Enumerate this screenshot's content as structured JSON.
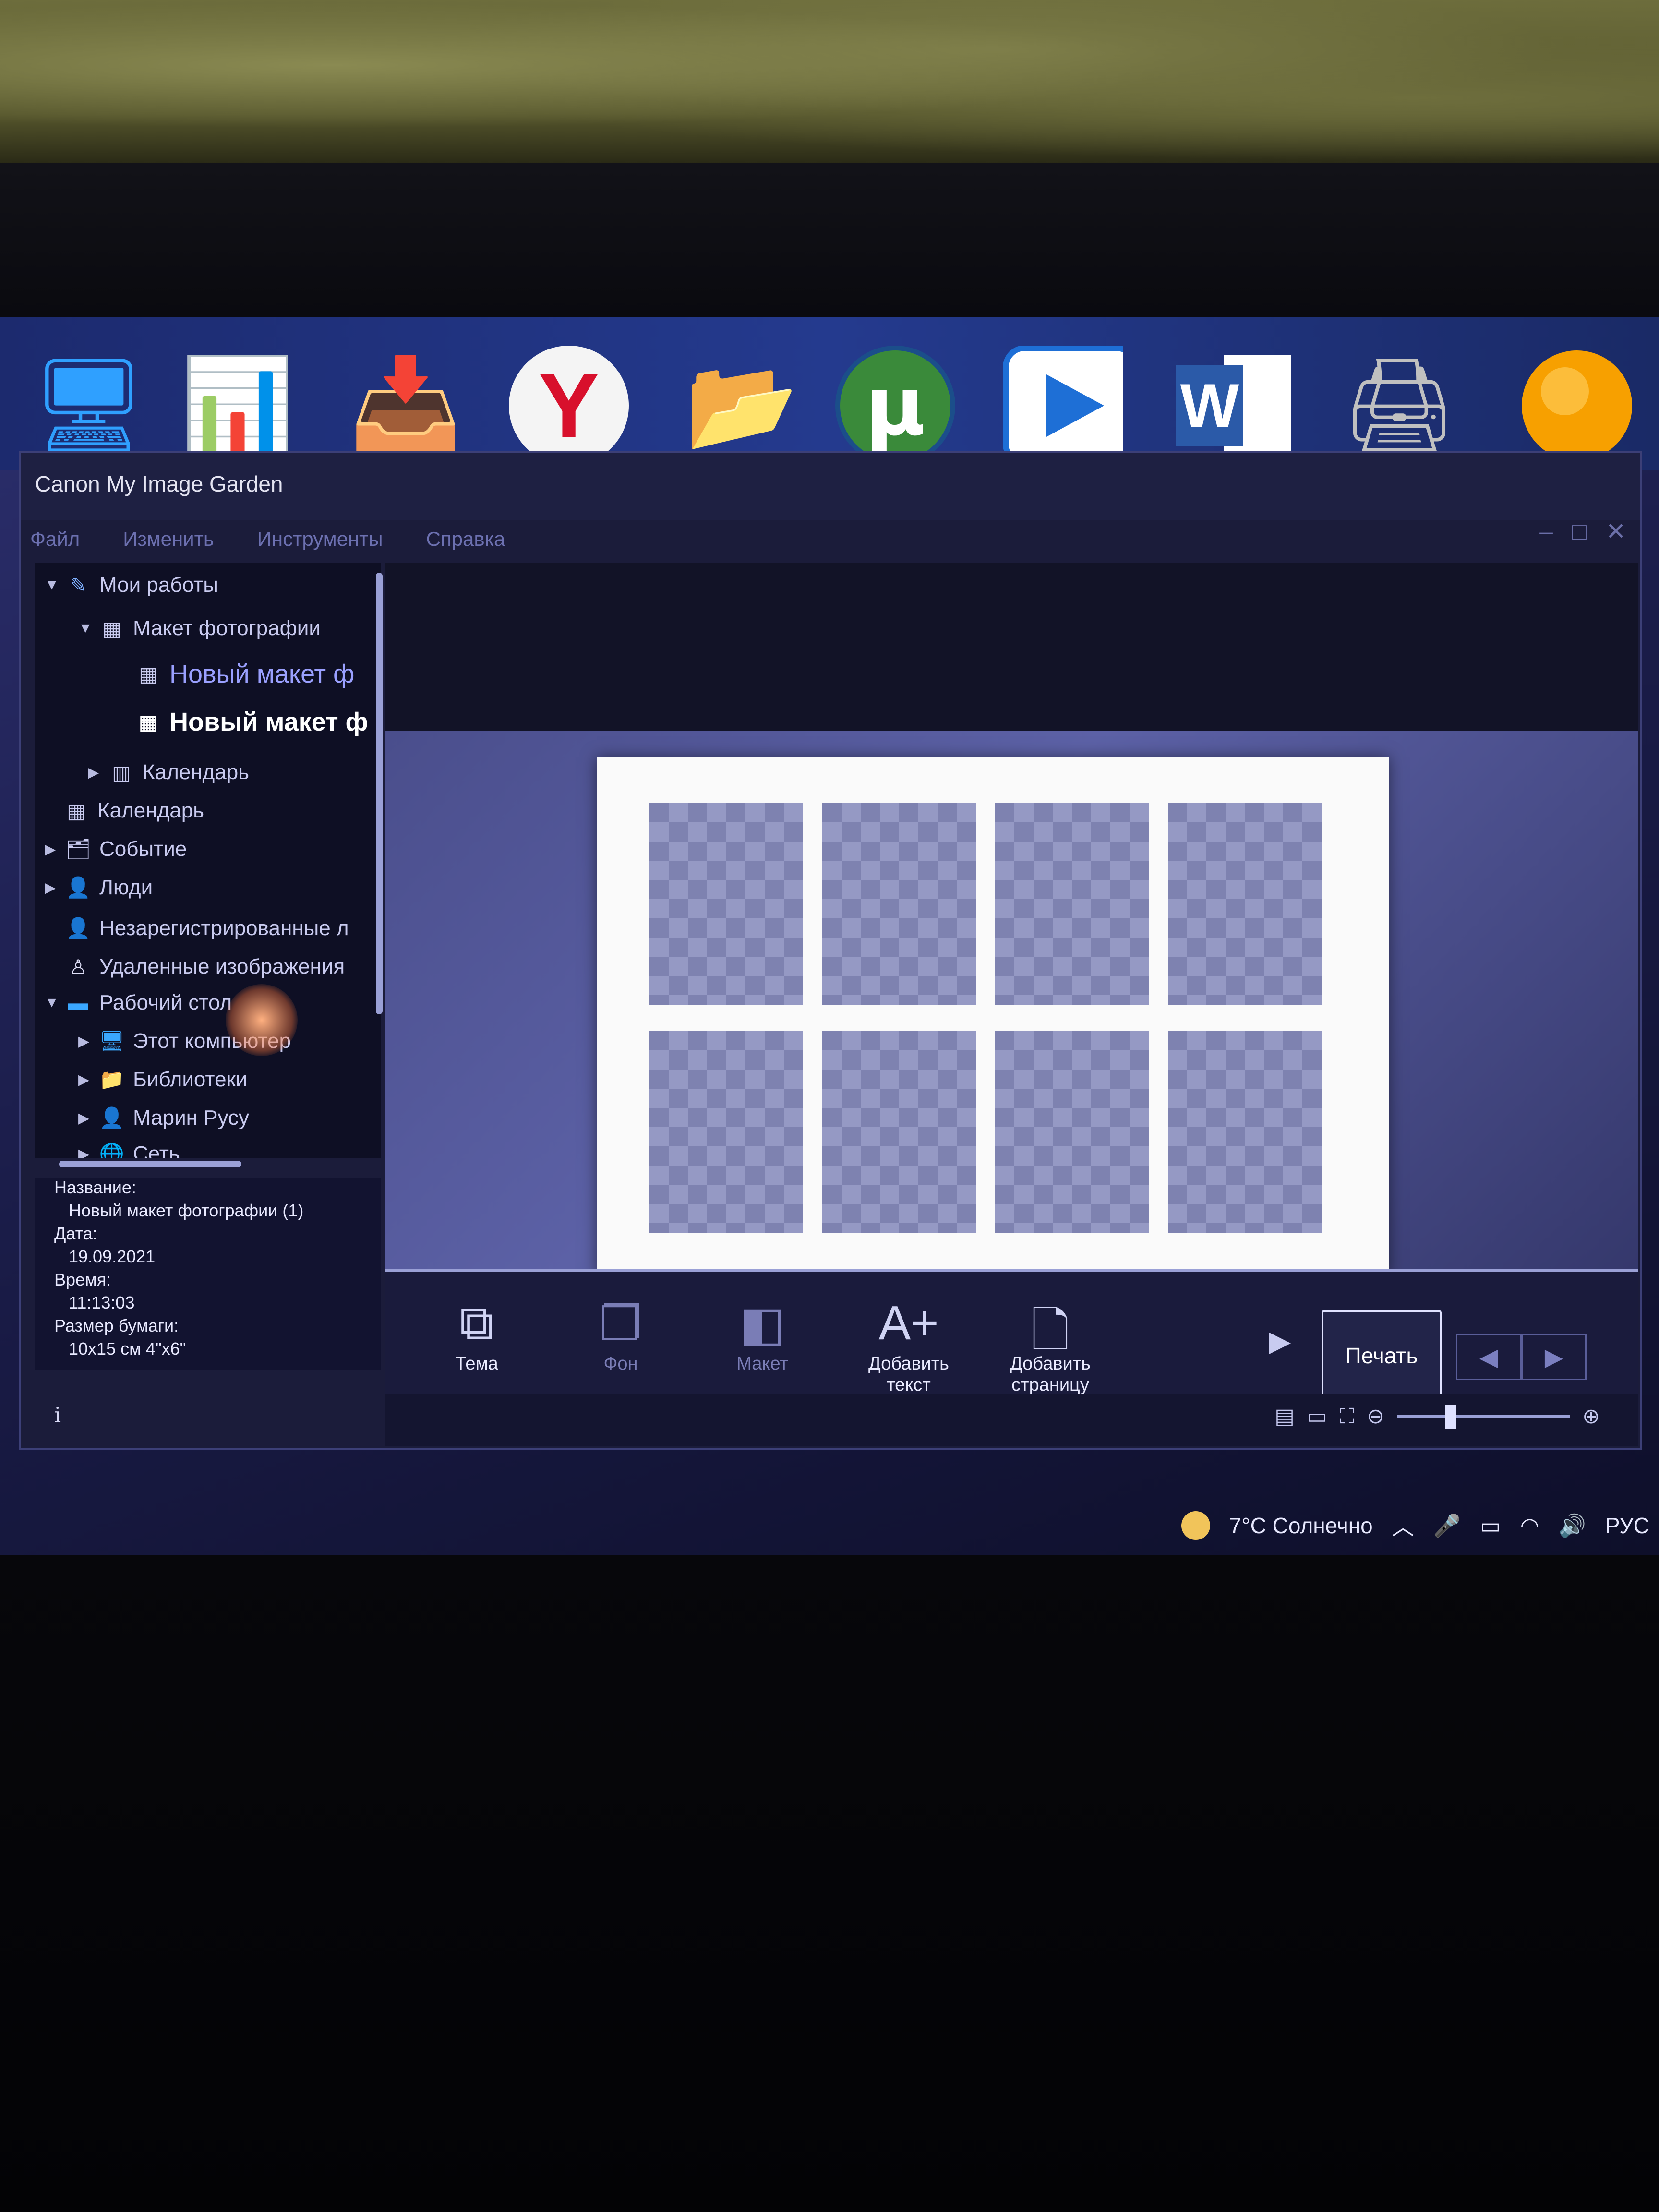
{
  "window": {
    "title": "Canon My Image Garden",
    "menu": [
      "Файл",
      "Изменить",
      "Инструменты",
      "Справка"
    ],
    "controls": [
      "–",
      "□",
      "✕"
    ]
  },
  "sidebar": {
    "tree": [
      {
        "label": "Мои работы",
        "icon": "my-works-icon"
      },
      {
        "label": "Макет фотографии",
        "icon": "layout-icon"
      },
      {
        "label": "Новый макет ф",
        "icon": "layout-icon"
      },
      {
        "label": "Новый макет ф",
        "icon": "layout-icon"
      },
      {
        "label": "Календарь",
        "icon": "calendar-icon"
      },
      {
        "label": "Календарь",
        "icon": "calendar-icon"
      },
      {
        "label": "Событие",
        "icon": "event-icon"
      },
      {
        "label": "Люди",
        "icon": "person-icon"
      },
      {
        "label": "Незарегистрированные л",
        "icon": "unregistered-person-icon"
      },
      {
        "label": "Удаленные изображения",
        "icon": "deleted-person-icon"
      },
      {
        "label": "Рабочий стол",
        "icon": "desktop-icon"
      },
      {
        "label": "Этот компьютер",
        "icon": "computer-icon"
      },
      {
        "label": "Библиотеки",
        "icon": "folder-icon"
      },
      {
        "label": "Марин Русу",
        "icon": "user-icon"
      },
      {
        "label": "Сеть",
        "icon": "network-icon"
      }
    ]
  },
  "info": {
    "name_label": "Название:",
    "name_value": "Новый макет фотографии (1)",
    "date_label": "Дата:",
    "date_value": "19.09.2021",
    "time_label": "Время:",
    "time_value": "11:13:03",
    "paper_label": "Размер бумаги:",
    "paper_value": "10x15 см 4\"x6\"",
    "info_icon": "i"
  },
  "toolbar": {
    "theme": "Тема",
    "background": "Фон",
    "layout": "Макет",
    "add_text": "Добавить текст",
    "add_page_line1": "Добавить",
    "add_page_line2": "страницу",
    "print": "Печать"
  },
  "tray": {
    "weather": "7°C  Солнечно",
    "lang": "РУС"
  },
  "colors": {
    "window_bg": "#1b1c3a",
    "canvas_bg": "#4a4e8c",
    "accent": "#9aa0ff"
  }
}
